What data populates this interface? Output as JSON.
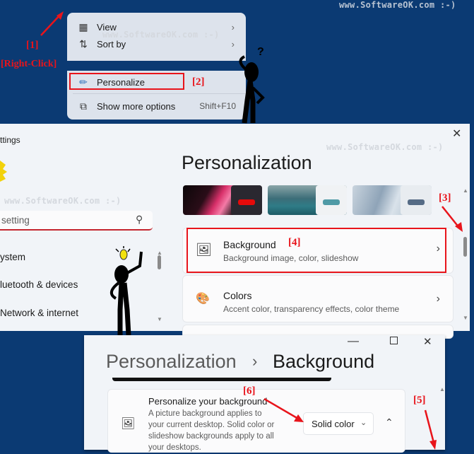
{
  "watermark": "www.SoftwareOK.com :-)",
  "annotations": {
    "a1": "[1]",
    "right_click": "[Right-Click]",
    "a2": "[2]",
    "a3": "[3]",
    "a4": "[4]",
    "a5": "[5]",
    "a6": "[6]"
  },
  "context_menu": {
    "items": [
      {
        "label": "View",
        "icon": "grid-icon",
        "submenu": true
      },
      {
        "label": "Sort by",
        "icon": "sort-icon",
        "submenu": true
      },
      {
        "label": "Personalize",
        "icon": "brush-icon",
        "highlighted": true
      },
      {
        "label": "Show more options",
        "icon": "open-external-icon",
        "shortcut": "Shift+F10"
      }
    ]
  },
  "settings_window": {
    "title": "ttings",
    "search_placeholder": "setting",
    "nav": [
      {
        "label": "ystem"
      },
      {
        "label": "luetooth & devices"
      },
      {
        "label": "Network & internet"
      }
    ],
    "page_title": "Personalization",
    "themes": [
      {
        "name": "dark-flower",
        "accent": "#e60a0a",
        "swatch_bg": "#2a2830"
      },
      {
        "name": "lake",
        "accent": "#4f9aa6",
        "swatch_bg": "#f0f2f4"
      },
      {
        "name": "bloom-light",
        "accent": "#556b85",
        "swatch_bg": "#e8ecf0"
      }
    ],
    "cards": [
      {
        "title": "Background",
        "subtitle": "Background image, color, slideshow",
        "icon": "image-icon"
      },
      {
        "title": "Colors",
        "subtitle": "Accent color, transparency effects, color theme",
        "icon": "palette-icon"
      }
    ]
  },
  "background_window": {
    "breadcrumb_parent": "Personalization",
    "breadcrumb_sep": "›",
    "breadcrumb_current": "Background",
    "setting": {
      "title": "Personalize your background",
      "description_lines": [
        "A picture background applies to",
        "your current desktop. Solid color or",
        "slideshow backgrounds apply to all",
        "your desktops."
      ],
      "dropdown_value": "Solid color"
    }
  },
  "colors": {
    "desktop": "#0b3a73",
    "annotation_red": "#e8141b"
  }
}
